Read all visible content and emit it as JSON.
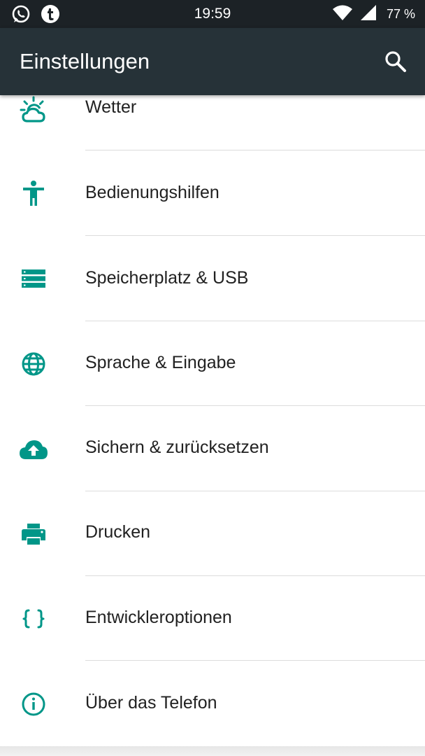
{
  "status_bar": {
    "time": "19:59",
    "battery": "77 %",
    "left_icons": [
      "whatsapp-icon",
      "tumblr-icon"
    ],
    "right_icons": [
      "wifi-icon",
      "cell-signal-icon"
    ]
  },
  "app_bar": {
    "title": "Einstellungen",
    "search_icon": "search-icon"
  },
  "colors": {
    "status_bar_bg": "#1c2226",
    "app_bar_bg": "#263238",
    "accent": "#009688",
    "text": "#212121",
    "divider": "#dcdcdc"
  },
  "settings": {
    "items": [
      {
        "label": "Wetter",
        "icon": "weather-icon"
      },
      {
        "label": "Bedienungshilfen",
        "icon": "accessibility-icon"
      },
      {
        "label": "Speicherplatz & USB",
        "icon": "storage-icon"
      },
      {
        "label": "Sprache & Eingabe",
        "icon": "globe-icon"
      },
      {
        "label": "Sichern & zurücksetzen",
        "icon": "cloud-upload-icon"
      },
      {
        "label": "Drucken",
        "icon": "printer-icon"
      },
      {
        "label": "Entwickleroptionen",
        "icon": "developer-braces-icon"
      },
      {
        "label": "Über das Telefon",
        "icon": "info-icon"
      }
    ]
  }
}
